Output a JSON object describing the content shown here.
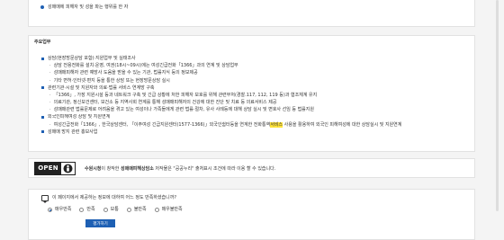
{
  "top": {
    "item": "성매매에 피해자 및 성을 파는 행위를 한 자"
  },
  "duties": {
    "title": "주요업무",
    "lines": [
      {
        "level": 1,
        "text": "상담(현장방문상담 포함)·지원업무 및 실태조사"
      },
      {
        "level": 2,
        "text": "상담 전용전화를 설치·운영, 여권(18시~09시)에는 여성긴급전화「1366」과의 연계 및 상담업무"
      },
      {
        "level": 2,
        "text": "성매매피해자 관련 예방사 도움을 받을 수 있는 기관, 법률지식 등의 정보제공"
      },
      {
        "level": 2,
        "text": "기타 면허·인터넷·편지 등을 통한 상담 또는 현장방문상담 실시"
      },
      {
        "level": 1,
        "text": "관련기관·시설 및 지원자와 의료·법률 서비스 연계망 구축"
      },
      {
        "level": 2,
        "text": "「1366」, 가장 지원시설 등과 네트워크 구축 및 긴급 상황에 처한 피해자 보호를 위해 관련부처(경찰.117, 112, 119 등)과 협조체계 유지"
      },
      {
        "level": 2,
        "text": "의료기관, 정신보건센터, 보건소 등 지역사회 연계를 통해 성매매피해자의 건강에 대한 진단 및 치료 등 의료서비스 제공"
      },
      {
        "level": 2,
        "text": "성매매관련 법률문제로 어려움을 겪고 있는 여성이나 가족들에게 관련 법률·절차, 유사 사례등에 대해 상담 실시 및 변호사 선임 등 법률지원"
      },
      {
        "level": 1,
        "text": "외국인피해여성 상담 및 지원연계"
      },
      {
        "level": 2,
        "text": "여성긴급전화「1366」, 한국상담센터, 「이주여성 긴급지원센터(1577-1366)」외국인쉼터등을 연계한 전화통역서비스 사용을 활용하여 외국인 피해여성에 대한 상담실시 및 지원연계",
        "highlight": "서비스"
      },
      {
        "level": 1,
        "text": "성매매 방지 관련 홍보사업"
      }
    ]
  },
  "license": {
    "logo_text": "OPEN",
    "agency": "수원시청",
    "middle": "이 창작한 ",
    "work": "성매매피해상담소",
    "suffix": " 저작물은 \"공공누리\" 출처표시 조건에 따라 이용 할 수 있습니다."
  },
  "survey": {
    "question": "이 페이지에서 제공하는 정보에 대하여 어느 정도 만족하셨습니까?",
    "options": [
      "매우만족",
      "만족",
      "보통",
      "불만족",
      "매우불만족"
    ],
    "selected_index": 0,
    "submit_label": "평가하기"
  }
}
